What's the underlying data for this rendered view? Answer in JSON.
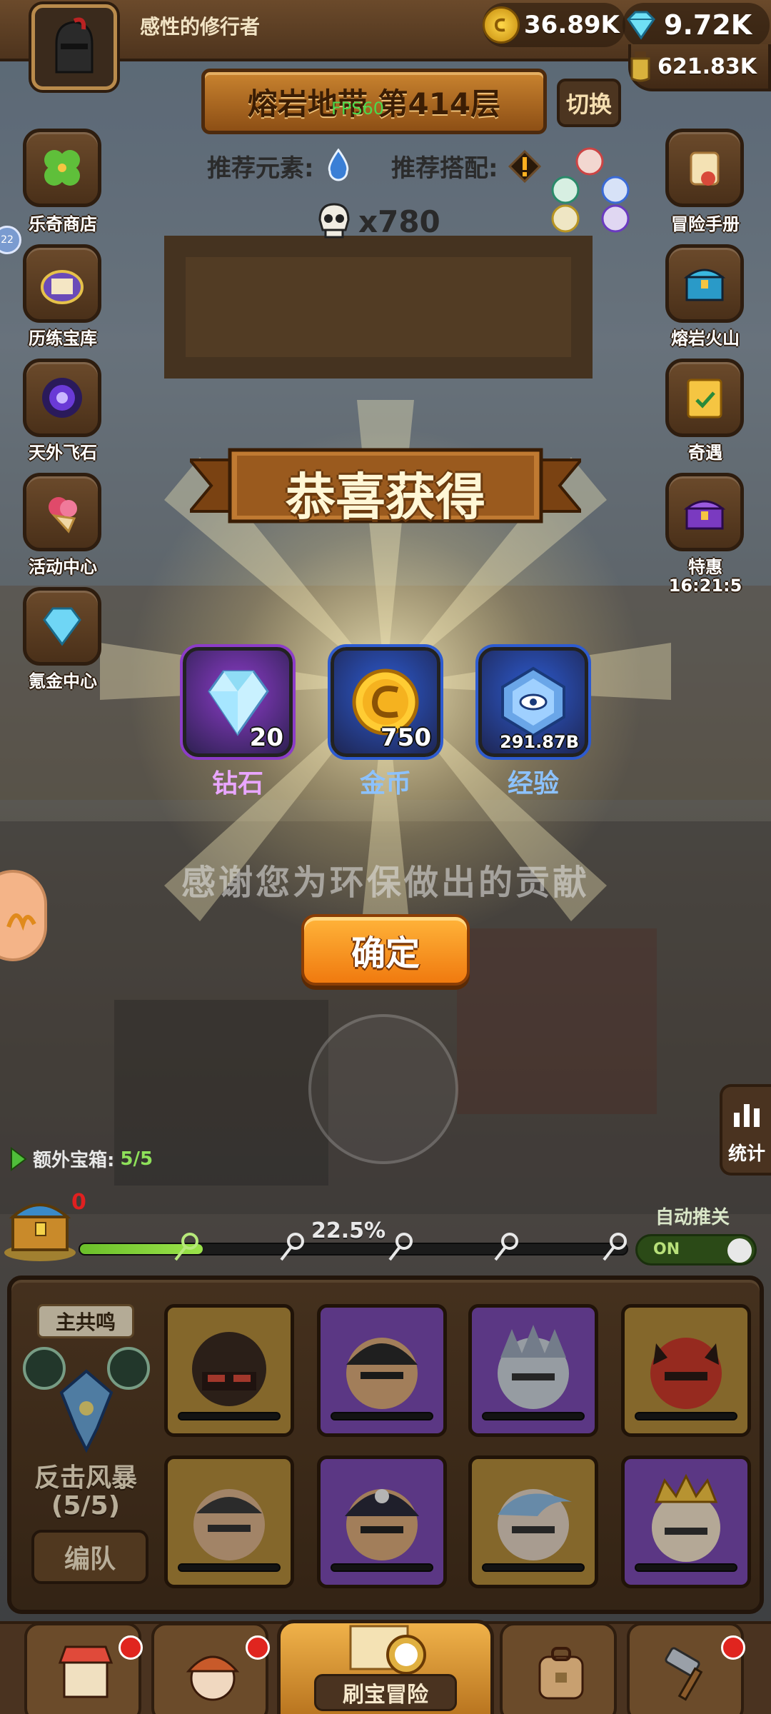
{
  "header": {
    "player_name": "感性的修行者",
    "gold": "36.89K",
    "gems": "9.72K",
    "potion": "621.83K"
  },
  "level": {
    "title": "熔岩地带 第414层",
    "fps": "FPS60",
    "switch_label": "切换",
    "recommend_element_label": "推荐元素:",
    "recommend_combo_label": "推荐搭配:",
    "kill_count": "x780"
  },
  "left_menu": [
    {
      "label": "乐奇商店",
      "icon": "clover-icon"
    },
    {
      "label": "历练宝库",
      "icon": "treasure-tome-icon"
    },
    {
      "label": "天外飞石",
      "icon": "vortex-icon"
    },
    {
      "label": "活动中心",
      "icon": "flower-bouquet-icon"
    },
    {
      "label": "氪金中心",
      "icon": "diamond-icon"
    }
  ],
  "right_menu": [
    {
      "label": "冒险手册",
      "icon": "scroll-icon"
    },
    {
      "label": "熔岩火山",
      "icon": "chest-icon"
    },
    {
      "label": "奇遇",
      "icon": "quest-board-icon"
    },
    {
      "label": "特惠",
      "timer": "16:21:5",
      "icon": "gift-chest-icon"
    }
  ],
  "modal": {
    "title": "恭喜获得",
    "rewards": [
      {
        "label": "钻石",
        "quantity": "20",
        "frame_color": "#8c3cc8",
        "label_color": "#e9a6ff"
      },
      {
        "label": "金币",
        "quantity": "750",
        "frame_color": "#2d5bd0",
        "label_color": "#8cc2ff"
      },
      {
        "label": "经验",
        "quantity": "291.87B",
        "frame_color": "#2d5bd0",
        "label_color": "#8cc2ff"
      }
    ],
    "message": "感谢您为环保做出的贡献",
    "confirm_label": "确定"
  },
  "hud": {
    "extra_chest_label": "额外宝箱:",
    "extra_chest_value": "5/5",
    "stats_label": "统计",
    "auto_push_label": "自动推关",
    "auto_push_state": "ON",
    "chest_count": "0",
    "progress_percent": 22.5,
    "progress_label": "22.5%"
  },
  "team": {
    "resonance_tag": "主共鸣",
    "skill_name": "反击风暴",
    "skill_count": "(5/5)",
    "formation_label": "编队"
  },
  "bottom_nav": {
    "main_label": "刷宝冒险"
  }
}
